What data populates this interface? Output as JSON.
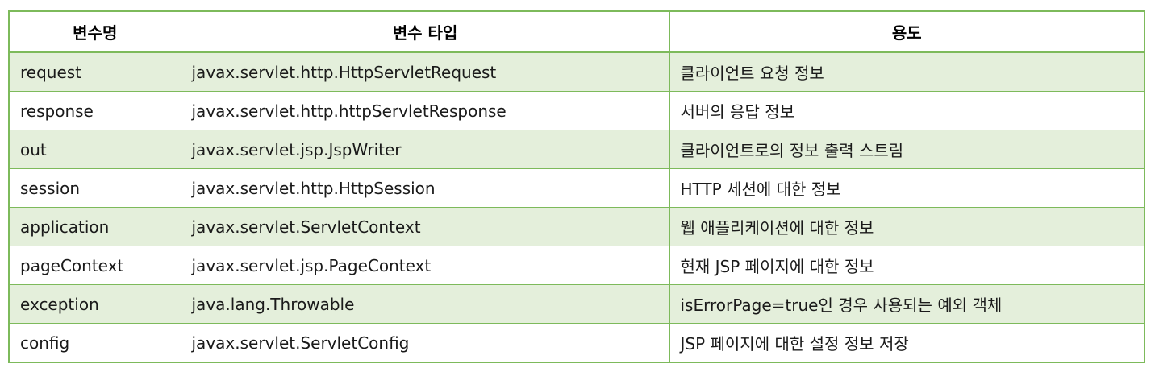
{
  "table": {
    "headers": [
      "변수명",
      "변수 타입",
      "용도"
    ],
    "rows": [
      [
        "request",
        "javax.servlet.http.HttpServletRequest",
        "클라이언트 요청 정보"
      ],
      [
        "response",
        "javax.servlet.http.httpServletResponse",
        "서버의 응답 정보"
      ],
      [
        "out",
        "javax.servlet.jsp.JspWriter",
        "클라이언트로의 정보 출력 스트림"
      ],
      [
        "session",
        "javax.servlet.http.HttpSession",
        "HTTP 세션에 대한 정보"
      ],
      [
        "application",
        "javax.servlet.ServletContext",
        "웹 애플리케이션에 대한 정보"
      ],
      [
        "pageContext",
        "javax.servlet.jsp.PageContext",
        "현재 JSP 페이지에 대한 정보"
      ],
      [
        "exception",
        "java.lang.Throwable",
        "isErrorPage=true인 경우 사용되는 예외 객체"
      ],
      [
        "config",
        "javax.servlet.ServletConfig",
        "JSP 페이지에 대한 설정 정보 저장"
      ]
    ]
  },
  "colors": {
    "border": "#7dba5b",
    "band": "#e4efdb",
    "header_bg": "#ffffff"
  }
}
